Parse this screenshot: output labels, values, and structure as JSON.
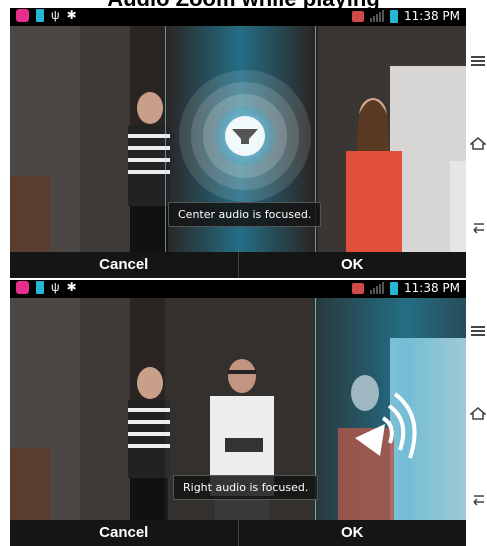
{
  "title": "Audio Zoom while playing",
  "status_bar": {
    "time": "11:38 PM"
  },
  "panels": [
    {
      "toast": "Center audio is focused.",
      "buttons": {
        "cancel": "Cancel",
        "ok": "OK"
      }
    },
    {
      "toast": "Right audio is focused.",
      "buttons": {
        "cancel": "Cancel",
        "ok": "OK"
      }
    }
  ],
  "nav_icons": [
    "menu-icon",
    "home-icon",
    "back-icon"
  ],
  "colors": {
    "focus_accent": "#1fa9d6",
    "status_bar": "#000000",
    "bottom_bar": "#151515"
  }
}
